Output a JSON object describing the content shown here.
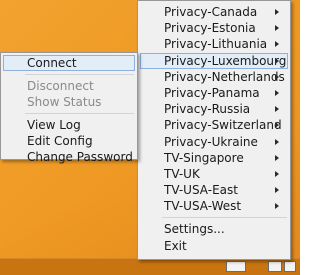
{
  "vpn_menu": {
    "items": [
      {
        "label": "Privacy-Canada"
      },
      {
        "label": "Privacy-Estonia"
      },
      {
        "label": "Privacy-Lithuania"
      },
      {
        "label": "Privacy-Luxembourg"
      },
      {
        "label": "Privacy-Netherlands"
      },
      {
        "label": "Privacy-Panama"
      },
      {
        "label": "Privacy-Russia"
      },
      {
        "label": "Privacy-Switzerland"
      },
      {
        "label": "Privacy-Ukraine"
      },
      {
        "label": "TV-Singapore"
      },
      {
        "label": "TV-UK"
      },
      {
        "label": "TV-USA-East"
      },
      {
        "label": "TV-USA-West"
      }
    ],
    "settings_label": "Settings...",
    "exit_label": "Exit"
  },
  "submenu": {
    "connect_label": "Connect",
    "disconnect_label": "Disconnect",
    "show_status_label": "Show Status",
    "view_log_label": "View Log",
    "edit_config_label": "Edit Config",
    "change_password_label": "Change Password"
  },
  "colors": {
    "desktop_orange": "#ef9a24",
    "menu_background": "#f0f0f0",
    "highlight": "#e3edf8",
    "highlight_border": "#8fb2dd",
    "disabled_text": "#8a8a8a"
  }
}
